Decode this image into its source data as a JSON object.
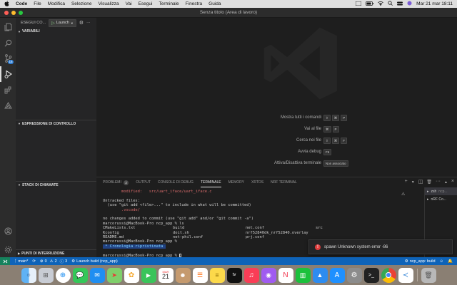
{
  "menubar": {
    "app": "Code",
    "items": [
      "File",
      "Modifica",
      "Selezione",
      "Visualizza",
      "Vai",
      "Esegui",
      "Terminale",
      "Finestra",
      "Guida"
    ],
    "datetime": "Mar 21 mar  18:11"
  },
  "window": {
    "title": "Senza titolo (Area di lavoro)"
  },
  "activity": {
    "badge": "16"
  },
  "sidebar": {
    "header": "ESEGUI CO...",
    "launch_label": "Launch",
    "sections": [
      "VARIABILI",
      "ESPRESSIONE DI CONTROLLO",
      "STACK DI CHIAMATE",
      "PUNTI DI INTERRUZIONE"
    ]
  },
  "shortcuts": [
    {
      "label": "Mostra tutti i comandi",
      "keys": [
        "⇧",
        "⌘",
        "P"
      ]
    },
    {
      "label": "Vai al file",
      "keys": [
        "⌘",
        "P"
      ]
    },
    {
      "label": "Cerca nei file",
      "keys": [
        "⇧",
        "⌘",
        "F"
      ]
    },
    {
      "label": "Avvia debug",
      "keys": [
        "F5"
      ]
    },
    {
      "label": "Attiva/Disattiva terminale",
      "keys": [
        "Non associato"
      ]
    }
  ],
  "panel": {
    "tabs": [
      "PROBLEMI",
      "OUTPUT",
      "CONSOLE DI DEBUG",
      "TERMINALE",
      "MEMORY",
      "XRTOS",
      "NRF TERMINAL"
    ],
    "problems_count": "2",
    "active_tab": "TERMINALE"
  },
  "terminal": {
    "modified_label": "        modified:   ",
    "modified_file": "src/uart_iface/uart_iface.c",
    "untracked": "Untracked files:",
    "untracked_hint": "  (use \"git add <file>...\" to include in what will be committed)",
    "vscode_dir": "        .vscode/",
    "no_changes": "no changes added to commit (use \"git add\" and/or \"git commit -a\")",
    "prompt_ls": "marcorussi@MacBook-Pro ncp_app % ls",
    "ls_rows": [
      [
        "CMakeLists.txt",
        "build",
        "net.conf",
        "src"
      ],
      [
        "Kconfig",
        "doit.sh",
        "nrf52840dk_nrf52840.overlay",
        ""
      ],
      [
        "README.md",
        "net-phil.conf",
        "prj.conf",
        ""
      ]
    ],
    "prompt_empty": "marcorussi@MacBook-Pro ncp_app % ",
    "history_restored": " * Cronologia ripristinata ",
    "prompt_current": "marcorussi@MacBook-Pro ncp_app % "
  },
  "terminal_list": [
    {
      "name": "zsh",
      "detail": "ncp..."
    },
    {
      "name": "nRF Co...",
      "detail": ""
    }
  ],
  "notification": {
    "message": "spawn Unknown system error -86"
  },
  "statusbar": {
    "branch": "main*",
    "errors": "0",
    "warnings": "2",
    "extra": "3",
    "task": "Launch build (ncp_app)",
    "right_task": "ncp_app: build"
  },
  "dock": {
    "calendar_day": "21",
    "calendar_month": "MAR",
    "icons": [
      "finder",
      "launchpad",
      "safari",
      "messages",
      "mail",
      "maps",
      "photos",
      "facetime",
      "calendar",
      "contacts",
      "reminders",
      "notes",
      "apple-tv",
      "music",
      "podcasts",
      "news",
      "numbers",
      "keynote",
      "app-store",
      "settings",
      "terminal",
      "chrome",
      "vscode",
      "trash"
    ]
  },
  "colors": {
    "accent": "#0e63b8",
    "remote": "#16825d",
    "error": "#e03c3c"
  }
}
